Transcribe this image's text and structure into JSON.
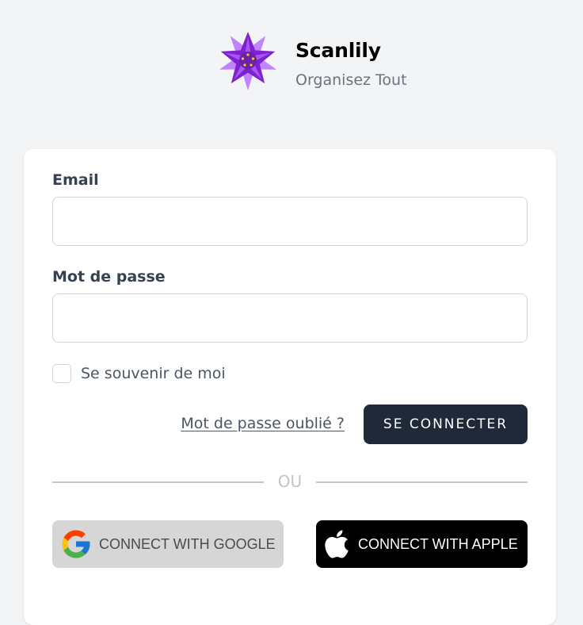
{
  "brand": {
    "name": "Scanlily",
    "tagline": "Organisez Tout",
    "logo_icon": "lily-flower-icon",
    "logo_colors": [
      "#7e22ce",
      "#a855f7",
      "#facc15"
    ]
  },
  "form": {
    "email_label": "Email",
    "email_value": "",
    "password_label": "Mot de passe",
    "password_value": "",
    "remember_label": "Se souvenir de moi",
    "remember_checked": false,
    "forgot_link": "Mot de passe oublié ?",
    "submit_label": "SE CONNECTER"
  },
  "divider": {
    "label": "OU"
  },
  "social": {
    "google_label": "CONNECT WITH GOOGLE",
    "google_icon": "google-icon",
    "apple_label": "CONNECT WITH APPLE",
    "apple_icon": "apple-icon"
  },
  "colors": {
    "background": "#f3f4f6",
    "card": "#ffffff",
    "primary_button": "#1f2937",
    "google_button": "#d6d6d6",
    "apple_button": "#000000"
  }
}
